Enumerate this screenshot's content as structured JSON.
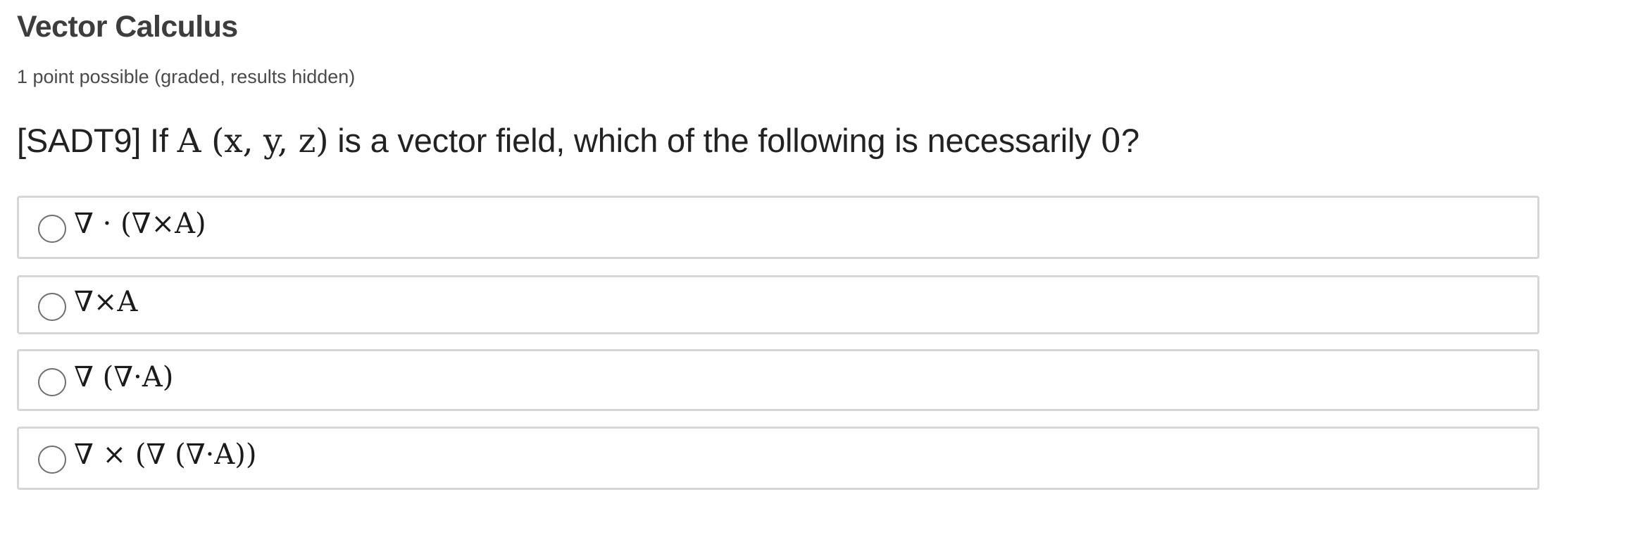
{
  "problem": {
    "title": "Vector Calculus",
    "progress": "1 point possible (graded, results hidden)",
    "question": {
      "prefix": "[SADT9] If ",
      "math_field": "A (x, y, z)",
      "middle": " is a vector field, which of the following is necessarily ",
      "math_zero": "0",
      "suffix": "?"
    },
    "choices": [
      {
        "label": "∇ · (∇×A)"
      },
      {
        "label": "∇×A"
      },
      {
        "label": "∇ (∇·A)"
      },
      {
        "label": "∇ × (∇ (∇·A))"
      }
    ]
  }
}
